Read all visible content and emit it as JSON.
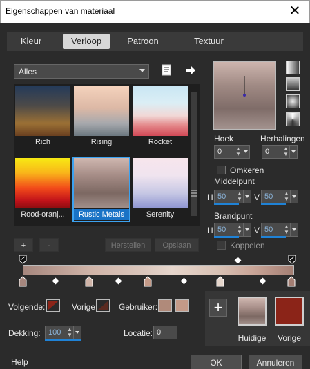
{
  "window": {
    "title": "Eigenschappen van materiaal"
  },
  "tabs": [
    "Kleur",
    "Verloop",
    "Patroon",
    "Textuur"
  ],
  "active_tab": "Verloop",
  "category_dropdown": {
    "value": "Alles"
  },
  "gradients": [
    {
      "label": "Rich",
      "selected": false
    },
    {
      "label": "Rising",
      "selected": false
    },
    {
      "label": "Rocket",
      "selected": false
    },
    {
      "label": "Rood-oranj...",
      "selected": false
    },
    {
      "label": "Rustic Metals",
      "selected": true
    },
    {
      "label": "Serenity",
      "selected": false
    }
  ],
  "gallery_buttons": {
    "add": "+",
    "remove": "-",
    "reset": "Herstellen",
    "save": "Opslaan"
  },
  "angle": {
    "label": "Hoek",
    "value": "0"
  },
  "repeats": {
    "label": "Herhalingen",
    "value": "0"
  },
  "invert": {
    "label": "Omkeren",
    "checked": false
  },
  "center": {
    "label": "Middelpunt",
    "h_label": "H",
    "h_value": "50",
    "v_label": "V",
    "v_value": "50"
  },
  "focus": {
    "label": "Brandpunt",
    "h_label": "H",
    "h_value": "50",
    "v_label": "V",
    "v_value": "50"
  },
  "link": {
    "label": "Koppelen",
    "checked": false
  },
  "stop_colors": {
    "following": {
      "label": "Volgende:"
    },
    "previous": {
      "label": "Vorige:"
    },
    "user": {
      "label": "Gebruiker:",
      "color1": "#b08a7a",
      "color2": "#c49a88"
    }
  },
  "opacity": {
    "label": "Dekking:",
    "value": "100"
  },
  "location": {
    "label": "Locatie:",
    "value": "0"
  },
  "current": {
    "label": "Huidige"
  },
  "previous_swatch": {
    "label": "Vorige",
    "color": "#8b2418"
  },
  "footer": {
    "help": "Help",
    "ok": "OK",
    "cancel": "Annuleren"
  }
}
